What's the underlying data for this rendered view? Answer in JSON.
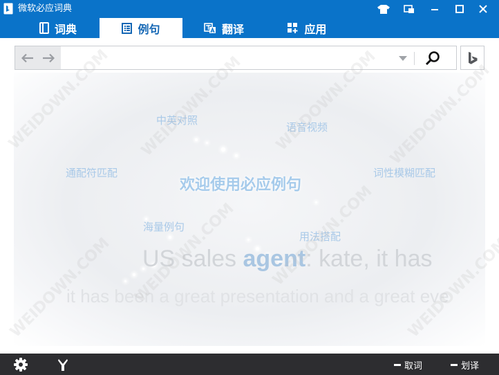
{
  "window": {
    "title": "微软必应词典",
    "controls": [
      "skin-icon",
      "mini-mode-icon",
      "minimize-icon",
      "maximize-icon",
      "close-icon"
    ]
  },
  "tabs": [
    {
      "label": "词典",
      "icon": "book-icon",
      "active": false
    },
    {
      "label": "例句",
      "icon": "sentence-icon",
      "active": true
    },
    {
      "label": "翻译",
      "icon": "translate-icon",
      "active": false
    },
    {
      "label": "应用",
      "icon": "apps-icon",
      "active": false
    }
  ],
  "search": {
    "value": "",
    "placeholder": ""
  },
  "stage": {
    "welcome": "欢迎使用必应例句",
    "keywords": {
      "bilingual": "中英对照",
      "audio_video": "语音视频",
      "wildcard": "通配符匹配",
      "pos_fuzzy": "词性模糊匹配",
      "massive": "海量例句",
      "usage": "用法搭配"
    },
    "example": {
      "before": "US sales ",
      "keyword": "agent",
      "after": ": kate, it has",
      "line2": "it has been a great presentation and a great eve"
    }
  },
  "watermark": "WEIDOWN.COM",
  "statusbar": {
    "lookup_label": "取词",
    "select_translate_label": "划译"
  },
  "colors": {
    "titlebar": "#0a73c9",
    "statusbar": "#2d2d30",
    "active_tab_text": "#1467b5"
  }
}
